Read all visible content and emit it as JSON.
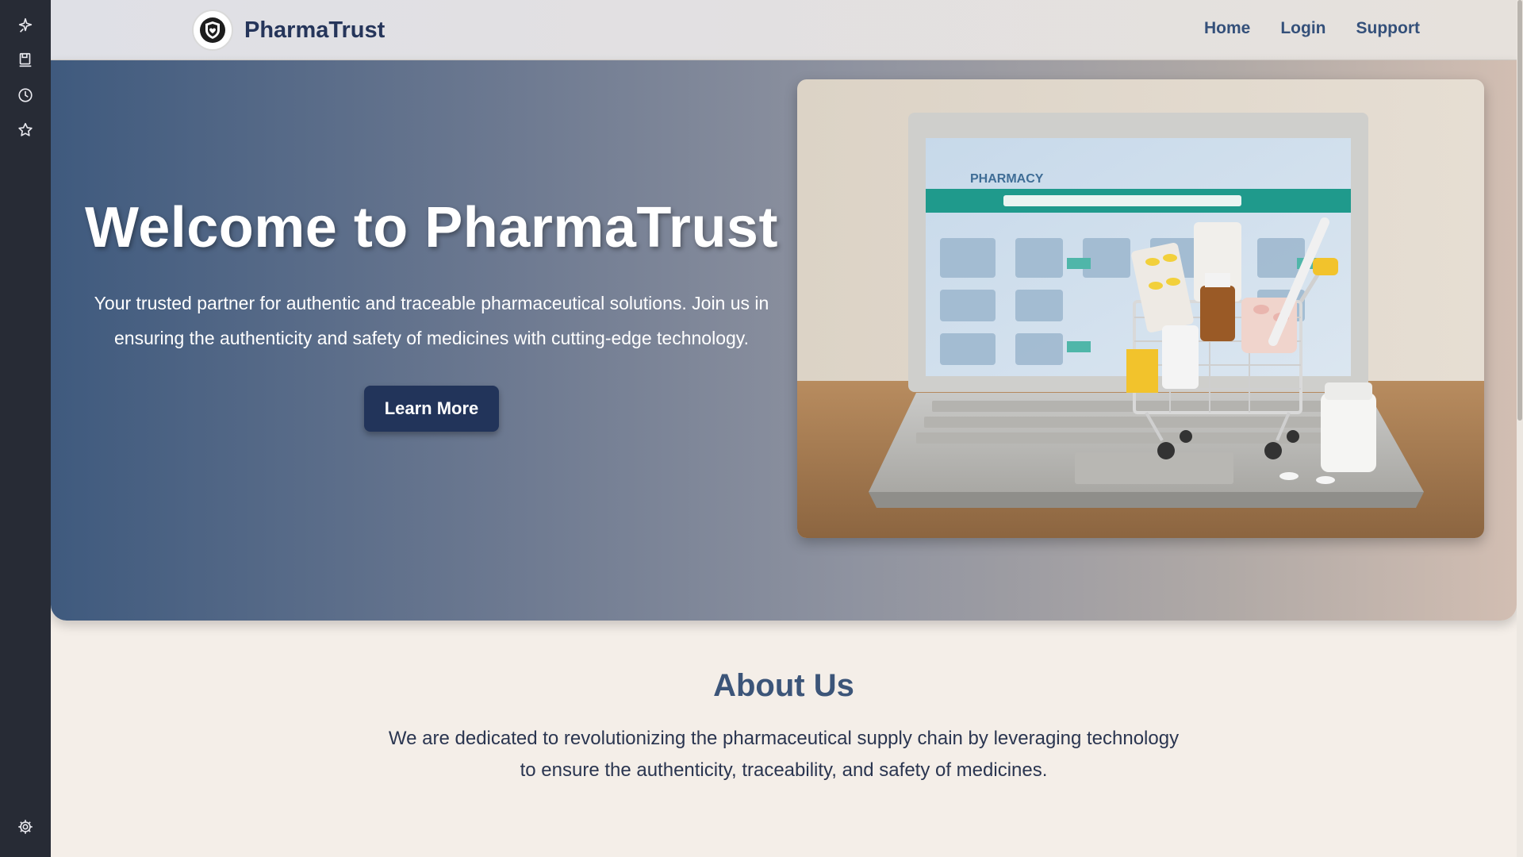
{
  "sidebar": {
    "icons": [
      "sparkle-pin-icon",
      "save-page-icon",
      "history-icon",
      "favorites-star-icon"
    ],
    "bottom_icon": "settings-gear-icon"
  },
  "header": {
    "brand_name": "PharmaTrust",
    "logo_icon": "shield-logo-icon",
    "nav": [
      "Home",
      "Login",
      "Support"
    ]
  },
  "hero": {
    "title": "Welcome to PharmaTrust",
    "subtitle": "Your trusted partner for authentic and traceable pharmaceutical solutions. Join us in ensuring the authenticity and safety of medicines with cutting-edge technology.",
    "button_label": "Learn More",
    "image_alt": "Laptop with pharmacy website and shopping cart of medicines",
    "image_screen_text": "PHARMACY"
  },
  "about": {
    "title": "About Us",
    "text": "We are dedicated to revolutionizing the pharmaceutical supply chain by leveraging technology to ensure the authenticity, traceability, and safety of medicines."
  },
  "colors": {
    "sidebar_bg": "#272b35",
    "brand_text": "#25355a",
    "nav_text": "#34507a",
    "button_bg": "#22345a",
    "page_bg": "#f4eee8",
    "about_title": "#3c5579"
  }
}
